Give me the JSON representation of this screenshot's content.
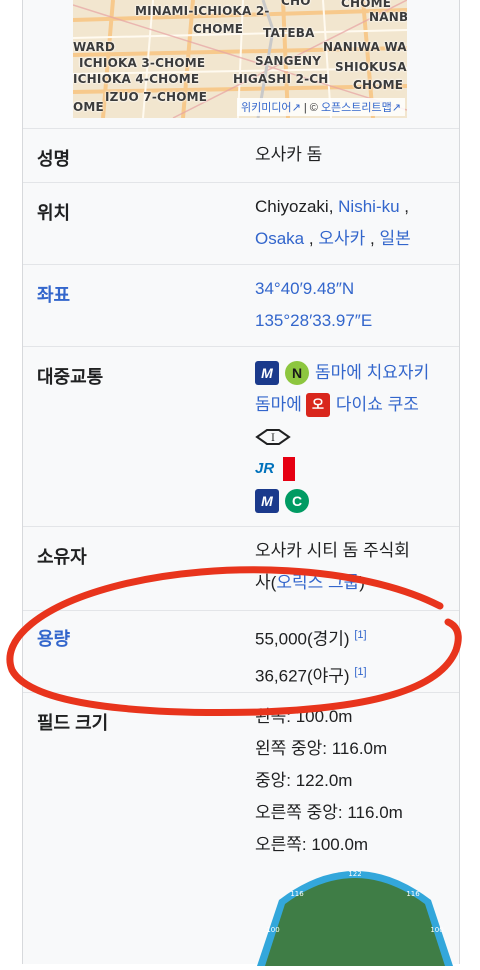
{
  "map": {
    "labels": [
      "MINAMI-ICHIOKA 2-",
      "CHOME",
      "TATEBA",
      "NANBA",
      "WARD",
      "NANIWA WARD",
      "SANGENY",
      "SHIOKUSA 2-",
      "ICHIOKA 3-CHOME",
      "ICHIOKA 4-CHOME",
      "HIGASHI 2-CH",
      "CHOME",
      "IZUO 7-CHOME",
      "OME",
      "CHOME",
      "CHO"
    ],
    "attribution_left": "위키미디어",
    "attribution_sep": "| ©",
    "attribution_right": "오픈스트리트맵"
  },
  "rows": {
    "name": {
      "label": "성명",
      "value": "오사카 돔"
    },
    "location": {
      "label": "위치",
      "v1": "Chiyozaki,",
      "v2": "Nishi-ku",
      "v3": ",",
      "v4": "Osaka",
      "v5": ",",
      "v6": "오사카",
      "v7": ",",
      "v8": "일본"
    },
    "coords": {
      "label": "좌표",
      "lat": "34°40′9.48″N",
      "lon": "135°28′33.97″E"
    },
    "transit": {
      "label": "대중교통",
      "line1_text": "돔마에 치요자키",
      "line2_text": "돔마에",
      "line2_text2": "다이쇼 쿠조",
      "badge_m": "M",
      "badge_n": "N",
      "badge_o": "오",
      "badge_c": "C",
      "jr": "JR"
    },
    "owner": {
      "label": "소유자",
      "v1": "오사카 시티 돔 주식회",
      "v2": "사(",
      "v3": "오릭스 그룹",
      "v4": ")"
    },
    "capacity": {
      "label": "용량",
      "v1": "55,000(경기)",
      "v2": "36,627(야구)",
      "ref1": "[1]",
      "ref2": "[1]"
    },
    "field": {
      "label": "필드 크기",
      "v1": "왼쪽: 100.0m",
      "v2": "왼쪽 중앙: 116.0m",
      "v3": "중앙: 122.0m",
      "v4": "오른쪽 중앙: 116.0m",
      "v5": "오른쪽: 100.0m"
    }
  },
  "diagram": {
    "center": "122",
    "lc": "116",
    "rc": "116",
    "left": "100",
    "right": "100"
  },
  "colors": {
    "link": "#3366cc",
    "annotation": "#e8341c",
    "field": "#3f7d46",
    "wall": "#33a7db"
  }
}
